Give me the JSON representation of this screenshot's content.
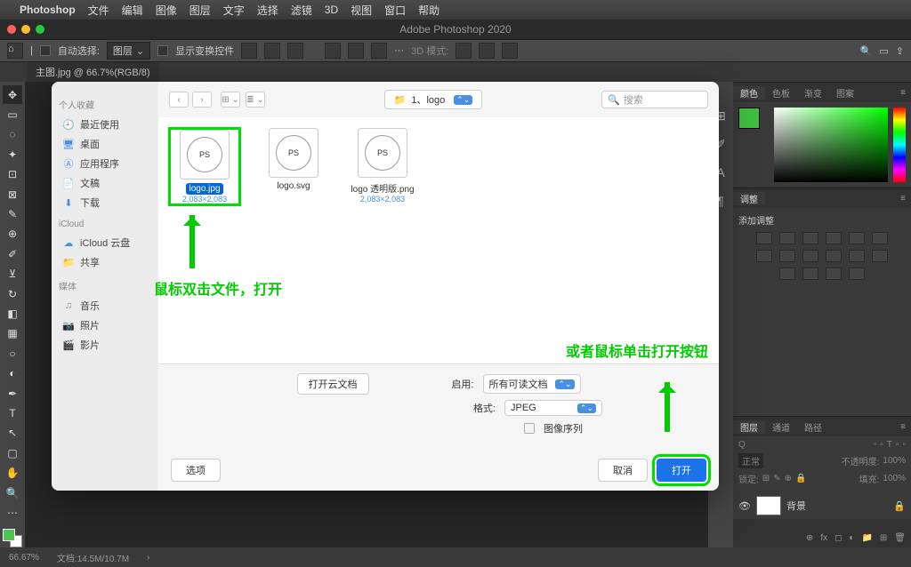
{
  "menubar": {
    "app": "Photoshop",
    "items": [
      "文件",
      "编辑",
      "图像",
      "图层",
      "文字",
      "选择",
      "滤镜",
      "3D",
      "视图",
      "窗口",
      "帮助"
    ]
  },
  "window_title": "Adobe Photoshop 2020",
  "options_bar": {
    "auto_select": "自动选择:",
    "layer_dd": "图层",
    "show_transform": "显示变换控件",
    "mode_3d": "3D 模式:"
  },
  "tab_title": "主图.jpg @ 66.7%(RGB/8)",
  "right_tabs": {
    "color": "颜色",
    "swatch": "色板",
    "grad": "渐变",
    "pattern": "图案",
    "adjust": "调整",
    "add_adjust": "添加调整",
    "layers": "图层",
    "channels": "通道",
    "paths": "路径",
    "normal": "正常",
    "opacity_lbl": "不透明度:",
    "opacity_val": "100%",
    "lock_lbl": "锁定:",
    "fill_lbl": "填充:",
    "fill_val": "100%",
    "bg_layer": "背景"
  },
  "status": {
    "zoom": "66.67%",
    "doc": "文档:14.5M/10.7M"
  },
  "dialog": {
    "sidebar": {
      "fav": "个人收藏",
      "recent": "最近使用",
      "desktop": "桌面",
      "apps": "应用程序",
      "docs": "文稿",
      "downloads": "下载",
      "icloud_hdr": "iCloud",
      "icloud": "iCloud 云盘",
      "shared": "共享",
      "media_hdr": "媒体",
      "music": "音乐",
      "photos": "照片",
      "movies": "影片"
    },
    "path": "1、logo",
    "search_ph": "搜索",
    "files": [
      {
        "name": "logo.jpg",
        "size": "2,083×2,083",
        "ps": "PS"
      },
      {
        "name": "logo.svg",
        "size": "",
        "ps": "PS"
      },
      {
        "name": "logo 透明版.png",
        "size": "2,083×2,083",
        "ps": "PS"
      }
    ],
    "cloud_btn": "打开云文档",
    "enable_lbl": "启用:",
    "enable_val": "所有可读文档",
    "format_lbl": "格式:",
    "format_val": "JPEG",
    "seq_lbl": "图像序列",
    "options_btn": "选项",
    "cancel": "取消",
    "open": "打开",
    "annot1": "鼠标双击文件，打开",
    "annot2": "或者鼠标单击打开按钮"
  }
}
